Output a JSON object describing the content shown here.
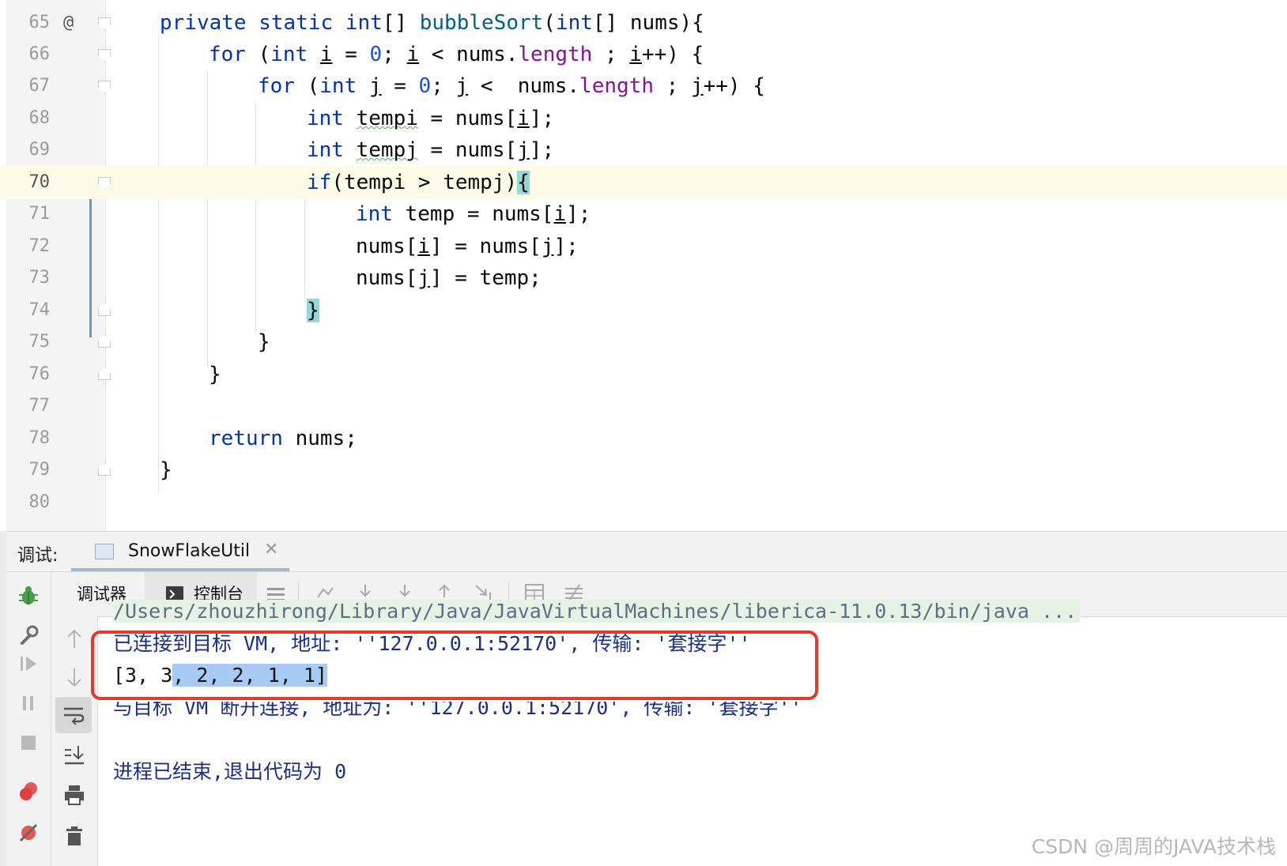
{
  "editor": {
    "lines": [
      {
        "num": "65",
        "annotation": "@"
      },
      {
        "num": "66"
      },
      {
        "num": "67"
      },
      {
        "num": "68"
      },
      {
        "num": "69"
      },
      {
        "num": "70"
      },
      {
        "num": "71"
      },
      {
        "num": "72"
      },
      {
        "num": "73"
      },
      {
        "num": "74"
      },
      {
        "num": "75"
      },
      {
        "num": "76"
      },
      {
        "num": "77"
      },
      {
        "num": "78"
      },
      {
        "num": "79"
      },
      {
        "num": "80"
      }
    ],
    "code": {
      "l65": {
        "private": "private",
        "static": "static",
        "int": "int",
        "arr": "[] ",
        "method": "bubbleSort",
        "rest": "(",
        "int2": "int",
        "rest2": "[] nums){"
      },
      "l66": {
        "for": "for",
        "a": " (",
        "int": "int",
        "b": " ",
        "i1": "i",
        "c": " = ",
        "zero": "0",
        "d": "; ",
        "i2": "i",
        "e": " < nums.",
        "len": "length",
        "f": " ; ",
        "i3": "i",
        "g": "++) {"
      },
      "l67": {
        "for": "for",
        "a": " (",
        "int": "int",
        "b": " ",
        "j1": "j",
        "c": " = ",
        "zero": "0",
        "d": "; ",
        "j2": "j",
        "e": " <  nums.",
        "len": "length",
        "f": " ; ",
        "j3": "j",
        "g": "++) {"
      },
      "l68": {
        "int": "int",
        "a": " ",
        "var": "tempi",
        "b": " = nums[",
        "i": "i",
        "c": "];"
      },
      "l69": {
        "int": "int",
        "a": " ",
        "var": "tempj",
        "b": " = nums[",
        "j": "j",
        "c": "];"
      },
      "l70": {
        "if": "if",
        "a": "(tempi > tempj)",
        "brace": "{"
      },
      "l71": {
        "int": "int",
        "a": " temp = nums[",
        "i": "i",
        "b": "];"
      },
      "l72": {
        "a": "nums[",
        "i": "i",
        "b": "] = nums[",
        "j": "j",
        "c": "];"
      },
      "l73": {
        "a": "nums[",
        "j": "j",
        "b": "] = temp;"
      },
      "l74": {
        "brace": "}"
      },
      "l75": {
        "brace": "}"
      },
      "l76": {
        "brace": "}"
      },
      "l78": {
        "return": "return",
        "a": " nums;"
      },
      "l79": {
        "brace": "}"
      }
    }
  },
  "debug": {
    "label": "调试:",
    "session_tab": "SnowFlakeUtil",
    "tabs": {
      "debugger": "调试器",
      "console": "控制台"
    }
  },
  "console": {
    "cmd": "/Users/zhouzhirong/Library/Java/JavaVirtualMachines/liberica-11.0.13/bin/java ...",
    "connected": "已连接到目标 VM, 地址: ''127.0.0.1:52170', 传输: '套接字''",
    "output_plain": "[3, 3",
    "output_selected": ", 2, 2, 1, 1]",
    "disconnected": "与目标 VM 断开连接, 地址为: ''127.0.0.1:52170', 传输: '套接字''",
    "exit": "进程已结束,退出代码为 0"
  },
  "watermark": "CSDN @周周的JAVA技术栈",
  "colors": {
    "keyword": "#0033b3",
    "number": "#1750eb",
    "field": "#871094",
    "method": "#00627a",
    "console_text": "#1b2e8a",
    "highlight_box": "#e23b2e",
    "selection": "#a7cbf4"
  }
}
